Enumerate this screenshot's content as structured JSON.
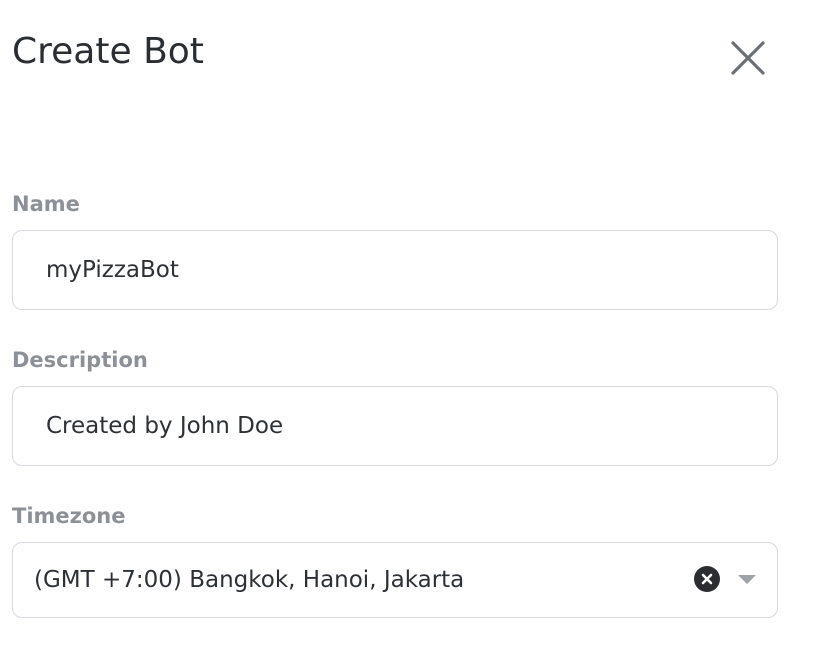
{
  "dialog": {
    "title": "Create Bot",
    "close_icon": "close-icon"
  },
  "form": {
    "name": {
      "label": "Name",
      "value": "myPizzaBot"
    },
    "description": {
      "label": "Description",
      "value": "Created by John Doe"
    },
    "timezone": {
      "label": "Timezone",
      "selected": "(GMT +7:00) Bangkok, Hanoi, Jakarta",
      "clear_icon": "clear-icon",
      "dropdown_icon": "chevron-down-icon"
    }
  },
  "colors": {
    "label": "#8c9198",
    "text": "#2d3136",
    "border": "#d6d9dd",
    "icon": "#6b6f75"
  }
}
